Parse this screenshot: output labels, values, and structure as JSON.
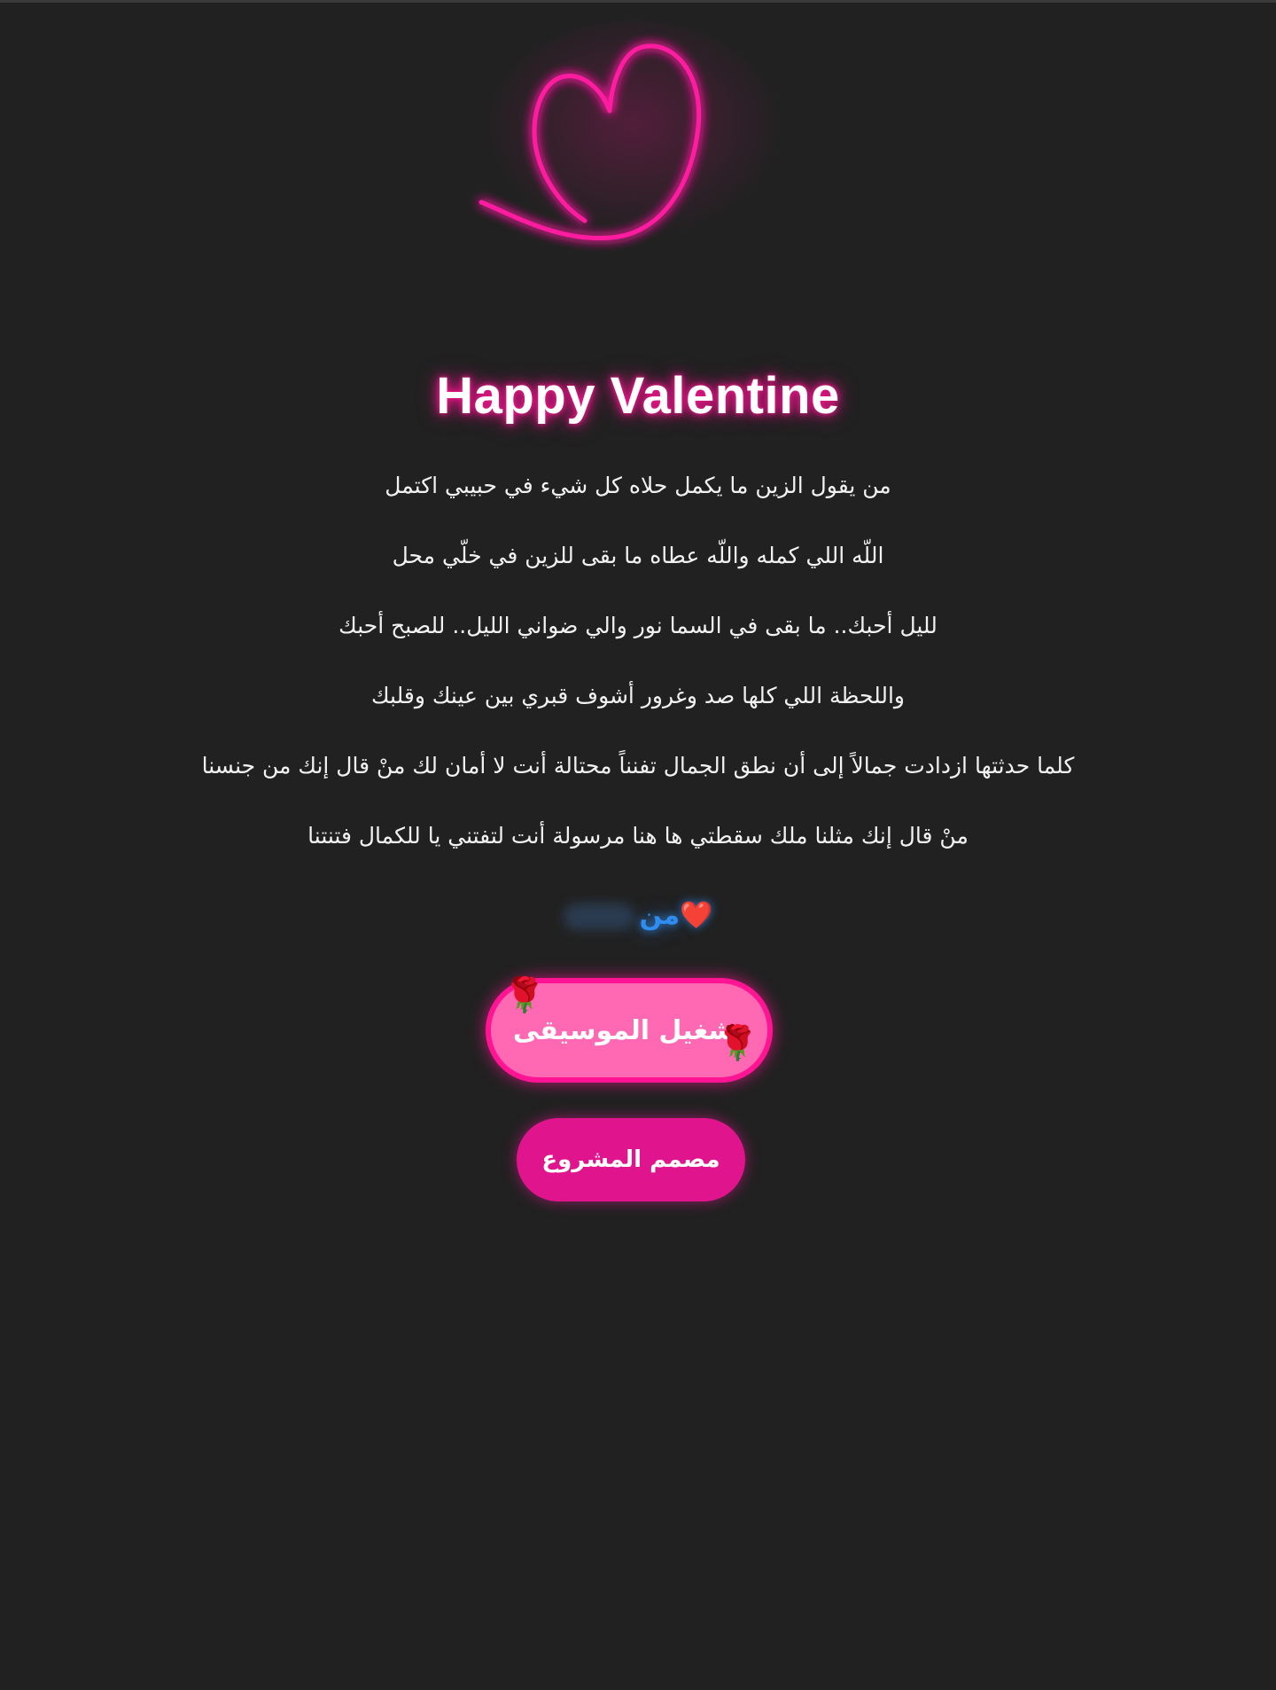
{
  "colors": {
    "background": "#212121",
    "neon_pink": "#ff1493",
    "music_button": "#ff69b4",
    "designer_button": "#e0158e",
    "from_blue": "#2f8cf0"
  },
  "header": {
    "icon": "neon-heart-outline",
    "title": "Happy Valentine"
  },
  "poem": {
    "lines": [
      "من يقول الزين ما يكمل حلاه كل شيء في حبيبي اكتمل",
      "اللّه اللي كمله واللّه عطاه ما بقى للزين في خلّي محل",
      "لليل أحبك.. ما بقى في السما نور والي ضواني الليل.. للصبح أحبك",
      "واللحظة اللي كلها صد وغرور أشوف قبري بين عينك وقلبك",
      "كلما حدثتها ازدادت جمالاً إلى أن نطق الجمال تفنناً محتالة أنت لا أمان لك منْ قال إنك من جنسنا",
      "منْ قال إنك مثلنا ملك سقطتي ها هنا مرسولة أنت لتفتني يا للكمال فتنتنا"
    ]
  },
  "from": {
    "text": "من",
    "heart": "❤️"
  },
  "buttons": {
    "music_label": "تشغيل الموسيقى",
    "music_icon": "rose-icon",
    "rose_glyph": "🌹",
    "designer_label": "مصمم المشروع"
  }
}
